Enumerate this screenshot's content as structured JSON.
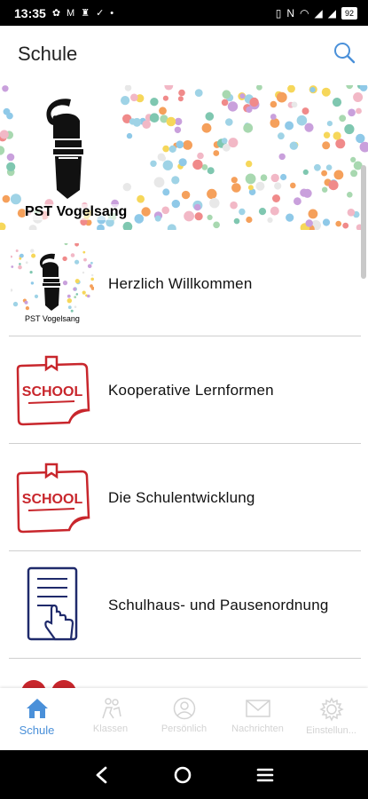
{
  "status_bar": {
    "time": "13:35",
    "icons_left": [
      "settings-icon",
      "gmail-icon",
      "bluetooth-headset-icon",
      "check-icon",
      "dot-icon"
    ],
    "icons_right": [
      "vibrate-icon",
      "nfc-icon",
      "wifi-icon",
      "signal-icon",
      "signal-icon"
    ],
    "battery": "92"
  },
  "app_bar": {
    "title": "Schule",
    "search_icon": "search-icon"
  },
  "banner": {
    "label": "PST Vogelsang"
  },
  "list": [
    {
      "label": "Herzlich Willkommen",
      "thumb_caption": "PST Vogelsang",
      "thumb": "school-logo"
    },
    {
      "label": "Kooperative Lernformen",
      "thumb": "school-note-icon"
    },
    {
      "label": "Die Schulentwicklung",
      "thumb": "school-note-icon"
    },
    {
      "label": "Schulhaus- und Pausenordnung",
      "thumb": "document-tap-icon"
    }
  ],
  "bottom_nav": [
    {
      "label": "Schule",
      "icon": "home-icon",
      "active": true
    },
    {
      "label": "Klassen",
      "icon": "class-icon",
      "active": false
    },
    {
      "label": "Persönlich",
      "icon": "person-icon",
      "active": false
    },
    {
      "label": "Nachrichten",
      "icon": "mail-icon",
      "active": false
    },
    {
      "label": "Einstellun...",
      "icon": "gear-icon",
      "active": false
    }
  ],
  "colors": {
    "accent": "#4a90d9",
    "school_red": "#c8262c",
    "doc_blue": "#1f2a6b",
    "crest": "#111111"
  }
}
